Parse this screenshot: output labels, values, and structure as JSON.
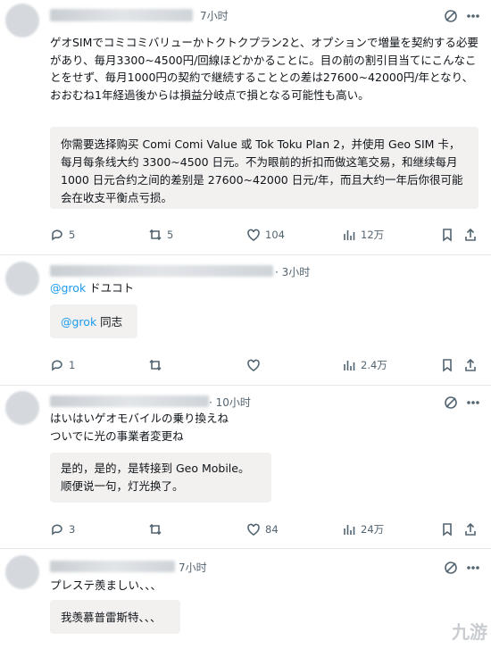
{
  "post1": {
    "time": "7小时",
    "text": "ゲオSIMでコミコミバリューかトクトクプラン2と、オプションで増量を契約する必要があり、毎月3300~4500円/回線ほどかかることに。目の前の割引目当てにこんなことをせず、毎月1000円の契約で継続することとの差は27600~42000円/年となり、おおむね1年経過後からは損益分岐点で損となる可能性も高い。",
    "translation": "你需要选择购买 Comi Comi Value 或 Tok Toku Plan 2，并使用 Geo SIM 卡，每月每条线大约 3300~4500 日元。不为眼前的折扣而做这笔交易，和继续每月 1000 日元合约之间的差别是 27600~42000 日元/年，而且大约一年后你很可能会在收支平衡点亏损。",
    "replies": "5",
    "reposts": "5",
    "likes": "104",
    "views": "12万"
  },
  "post2": {
    "time": "· 3小时",
    "mention": "@grok",
    "text_suffix": " ドユコト",
    "translation_mention": "@grok",
    "translation_suffix": " 同志",
    "replies": "1",
    "reposts": "",
    "likes": "",
    "views": "2.4万"
  },
  "post3": {
    "time": "· 10小时",
    "line1": "はいはいゲオモバイルの乗り換えね",
    "line2": "ついでに光の事業者変更ね",
    "translation_line1": "是的，是的，是转接到 Geo Mobile。",
    "translation_line2": "顺便说一句，灯光换了。",
    "replies": "3",
    "reposts": "",
    "likes": "84",
    "views": "24万"
  },
  "post4": {
    "time": "7小时",
    "text": "プレステ羨ましい、、、",
    "translation": "我羡慕普雷斯特、、、"
  },
  "watermark": "九游",
  "colors": {
    "link": "#1d9bf0",
    "muted": "#536471",
    "translation_bg": "#f3f1f0"
  }
}
